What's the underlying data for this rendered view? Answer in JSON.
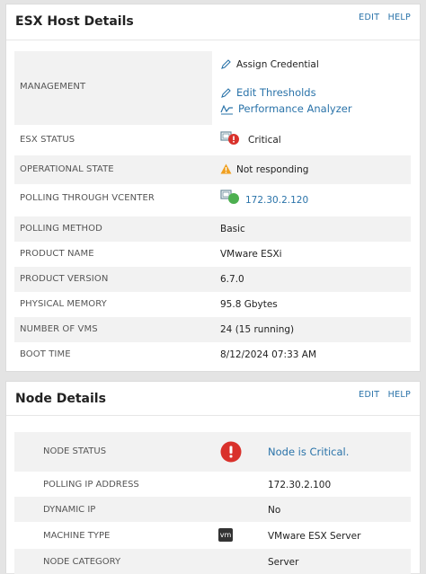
{
  "esx_panel": {
    "title": "ESX Host Details",
    "edit": "EDIT",
    "help": "HELP",
    "management": {
      "label": "MANAGEMENT",
      "assign_credential": "Assign Credential",
      "edit_thresholds": "Edit Thresholds",
      "performance_analyzer": "Performance Analyzer"
    },
    "rows": [
      {
        "label": "ESX STATUS",
        "value": "Critical"
      },
      {
        "label": "OPERATIONAL STATE",
        "value": "Not responding"
      },
      {
        "label": "POLLING THROUGH VCENTER",
        "value": "172.30.2.120"
      },
      {
        "label": "POLLING METHOD",
        "value": "Basic"
      },
      {
        "label": "PRODUCT NAME",
        "value": "VMware ESXi"
      },
      {
        "label": "PRODUCT VERSION",
        "value": "6.7.0"
      },
      {
        "label": "PHYSICAL MEMORY",
        "value": "95.8 Gbytes"
      },
      {
        "label": "NUMBER OF VMS",
        "value": "24 (15 running)"
      },
      {
        "label": "BOOT TIME",
        "value": "8/12/2024 07:33 AM"
      }
    ]
  },
  "node_panel": {
    "title": "Node Details",
    "edit": "EDIT",
    "help": "HELP",
    "rows": [
      {
        "label": "NODE STATUS",
        "value": "Node is Critical."
      },
      {
        "label": "POLLING IP ADDRESS",
        "value": "172.30.2.100"
      },
      {
        "label": "DYNAMIC IP",
        "value": "No"
      },
      {
        "label": "MACHINE TYPE",
        "value": "VMware ESX Server",
        "icon_text": "vm"
      },
      {
        "label": "NODE CATEGORY",
        "value": "Server"
      }
    ]
  },
  "colors": {
    "link": "#2a73a9",
    "critical": "#d9312b",
    "warning": "#f0a020",
    "up": "#4caf50"
  }
}
